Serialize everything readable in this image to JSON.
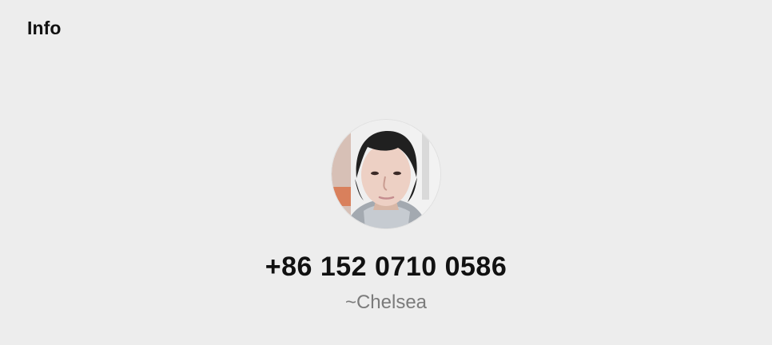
{
  "header": {
    "title": "Info"
  },
  "contact": {
    "phone": "+86 152 0710 0586",
    "nickname": "~Chelsea",
    "avatar_icon": "profile-photo"
  },
  "colors": {
    "background": "#ededed",
    "title": "#111111",
    "nickname": "#7b7b7b"
  }
}
